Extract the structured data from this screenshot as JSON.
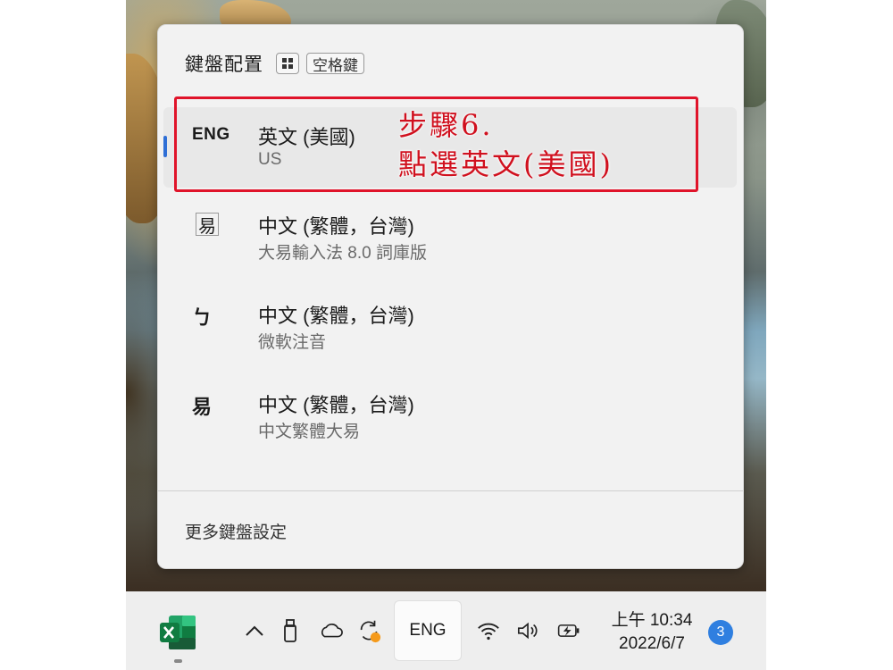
{
  "flyout": {
    "title": "鍵盤配置",
    "shortcut_key_windows": "windows-key-icon",
    "shortcut_key_space": "空格鍵",
    "layouts": [
      {
        "icon_text": "ENG",
        "name": "英文 (美國)",
        "detail": "US",
        "selected": true
      },
      {
        "icon_text": "易",
        "name": "中文 (繁體，台灣)",
        "detail": "大易輸入法 8.0 詞庫版",
        "selected": false
      },
      {
        "icon_text": "ㄅ",
        "name": "中文 (繁體，台灣)",
        "detail": "微軟注音",
        "selected": false
      },
      {
        "icon_text": "易",
        "name": "中文 (繁體，台灣)",
        "detail": "中文繁體大易",
        "selected": false
      }
    ],
    "more_settings": "更多鍵盤設定"
  },
  "annotation": {
    "line1": "步驟6.",
    "line2": "點選英文(美國)",
    "color": "#d0101e"
  },
  "taskbar": {
    "pinned_app": "excel-icon",
    "tray_icons": [
      "chevron-up-icon",
      "usb-drive-icon",
      "onedrive-cloud-icon",
      "sync-icon",
      "wifi-icon",
      "volume-icon",
      "battery-charging-icon"
    ],
    "language_indicator": "ENG",
    "clock_time": "上午 10:34",
    "clock_date": "2022/6/7",
    "notification_count": "3"
  },
  "colors": {
    "accent": "#2f6fd6",
    "annotation_red": "#e0142a",
    "flyout_bg": "#f2f2f2",
    "badge": "#2f7fe0"
  }
}
